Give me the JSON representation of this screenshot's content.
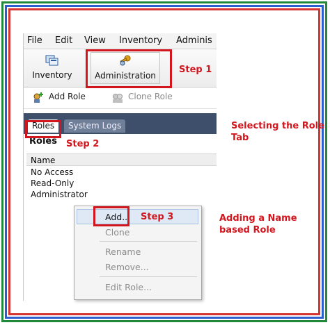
{
  "menubar": {
    "items": [
      "File",
      "Edit",
      "View",
      "Inventory",
      "Adminis"
    ]
  },
  "toolbar": {
    "inventory_label": "Inventory",
    "administration_label": "Administration"
  },
  "actions": {
    "add_role": "Add Role",
    "clone_role": "Clone Role"
  },
  "tabs": {
    "roles": "Roles",
    "system_logs": "System Logs"
  },
  "roles_section": {
    "title": "Roles",
    "column": "Name",
    "rows": [
      "No Access",
      "Read-Only",
      "Administrator"
    ]
  },
  "context_menu": {
    "add": "Add...",
    "clone": "Clone",
    "rename": "Rename",
    "remove": "Remove...",
    "edit_role": "Edit Role..."
  },
  "annotations": {
    "step1": "Step 1",
    "step2": "Step 2",
    "step3": "Step 3",
    "note_tab_line1": "Selecting the Role",
    "note_tab_line2": "Tab",
    "note_add_line1": "Adding a Name",
    "note_add_line2": "based Role"
  },
  "colors": {
    "highlight": "#d2161e",
    "frame_green": "#1f8a3a",
    "frame_blue": "#2b5fd0",
    "frame_red": "#d63333"
  }
}
